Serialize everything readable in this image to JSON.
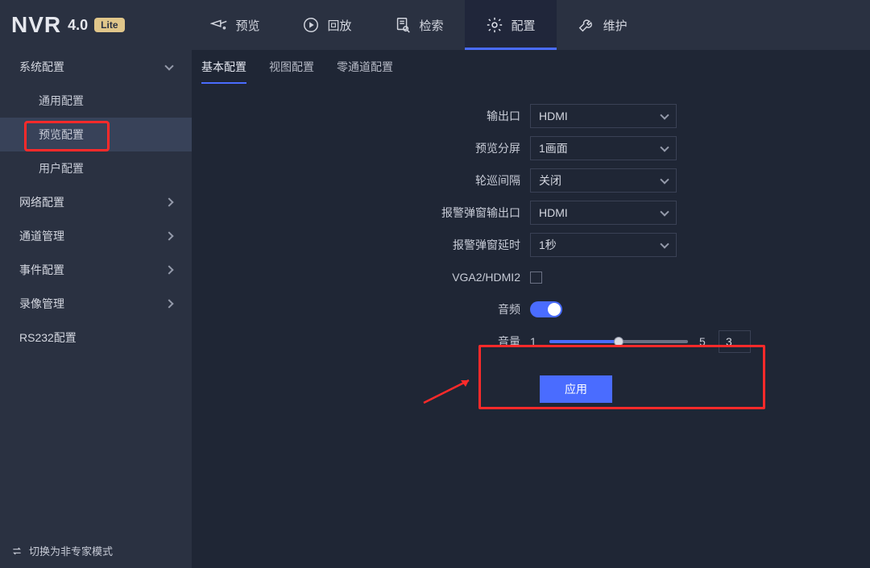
{
  "brand": {
    "name": "NVR",
    "version": "4.0",
    "edition": "Lite"
  },
  "topnav": {
    "preview": "预览",
    "playback": "回放",
    "search": "检索",
    "config": "配置",
    "maintain": "维护"
  },
  "sidebar": {
    "system": "系统配置",
    "general": "通用配置",
    "preview": "预览配置",
    "user": "用户配置",
    "network": "网络配置",
    "channel": "通道管理",
    "event": "事件配置",
    "record": "录像管理",
    "rs232": "RS232配置",
    "footer": "切换为非专家模式"
  },
  "subtabs": {
    "basic": "基本配置",
    "view": "视图配置",
    "zero": "零通道配置"
  },
  "form": {
    "output_label": "输出口",
    "output_value": "HDMI",
    "split_label": "预览分屏",
    "split_value": "1画面",
    "interval_label": "轮巡间隔",
    "interval_value": "关闭",
    "alarm_out_label": "报警弹窗输出口",
    "alarm_out_value": "HDMI",
    "alarm_delay_label": "报警弹窗延时",
    "alarm_delay_value": "1秒",
    "vga_label": "VGA2/HDMI2",
    "audio_label": "音频",
    "volume_label": "音量",
    "volume_min": "1",
    "volume_max": "5",
    "volume_value": "3",
    "apply": "应用"
  }
}
